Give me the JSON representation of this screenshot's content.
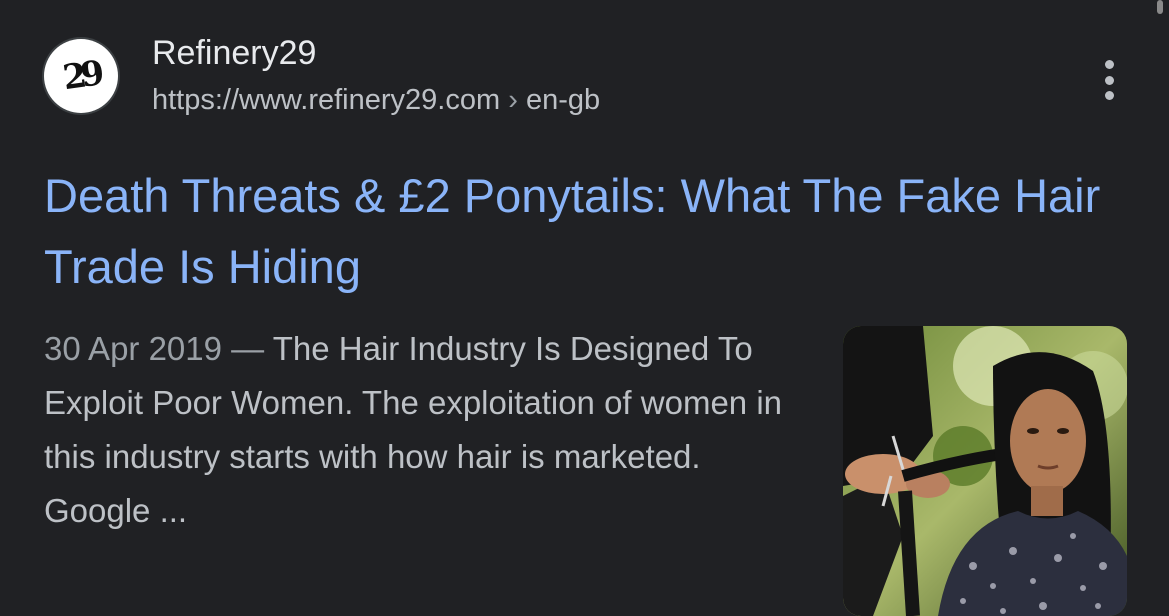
{
  "result": {
    "site_icon_text": "29",
    "site_name": "Refinery29",
    "url": "https://www.refinery29.com",
    "breadcrumb_sep": "›",
    "breadcrumb": "en-gb",
    "more_icon": "more-vert-icon",
    "title": "Death Threats & £2 Ponytails: What The Fake Hair Trade Is Hiding",
    "date": "30 Apr 2019",
    "date_sep": " — ",
    "snippet": "The Hair Industry Is Designed To Exploit Poor Women. The exploitation of women in this industry starts with how hair is marketed. Google ...",
    "thumbnail_icon": "hair-cutting-photo"
  },
  "colors": {
    "background": "#202124",
    "title_link": "#8ab4f8",
    "text_primary": "#e8eaed",
    "text_secondary": "#bdc1c6"
  }
}
